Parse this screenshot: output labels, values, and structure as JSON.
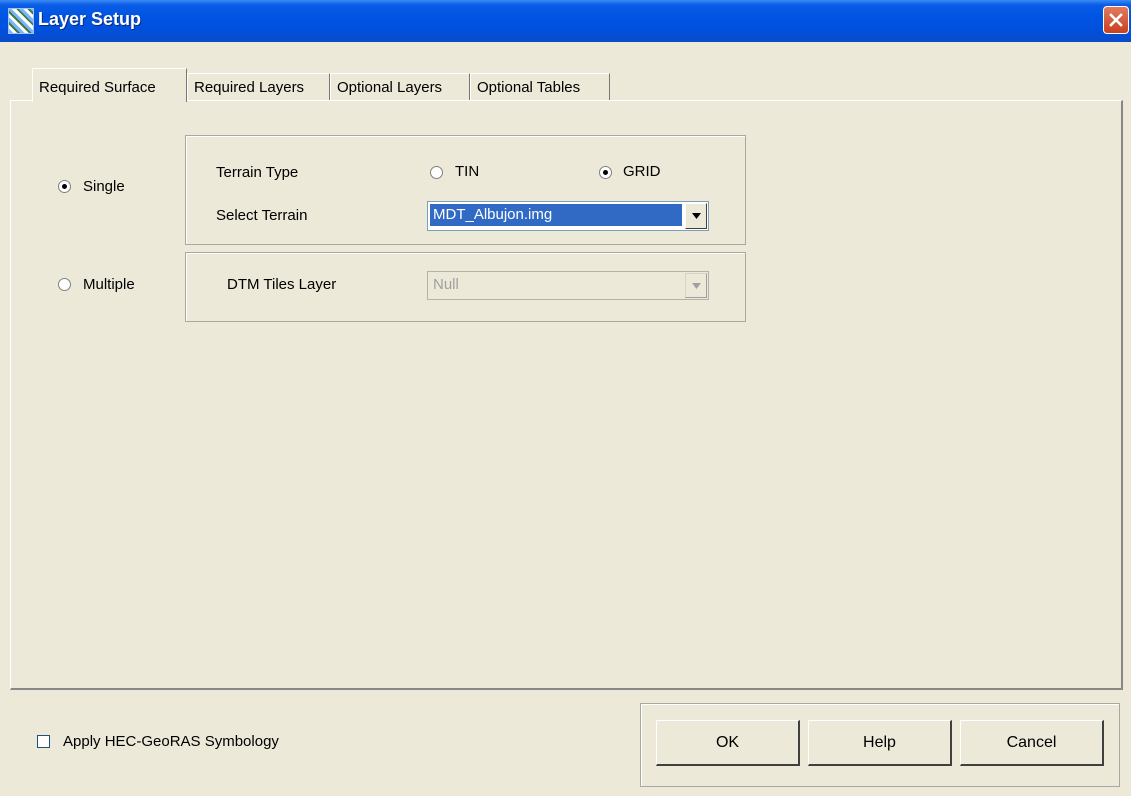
{
  "window": {
    "title": "Layer Setup"
  },
  "tabs": [
    {
      "label": "Required Surface",
      "active": true
    },
    {
      "label": "Required Layers",
      "active": false
    },
    {
      "label": "Optional Layers",
      "active": false
    },
    {
      "label": "Optional Tables",
      "active": false
    }
  ],
  "surface": {
    "single_label": "Single",
    "multiple_label": "Multiple",
    "selected_mode": "Single",
    "terrain_type_label": "Terrain Type",
    "tin_label": "TIN",
    "grid_label": "GRID",
    "selected_terrain_type": "GRID",
    "select_terrain_label": "Select Terrain",
    "select_terrain_value": "MDT_Albujon.img",
    "dtm_tiles_label": "DTM Tiles Layer",
    "dtm_tiles_value": "Null"
  },
  "footer": {
    "symbology_label": "Apply HEC-GeoRAS Symbology",
    "symbology_checked": false,
    "ok_label": "OK",
    "help_label": "Help",
    "cancel_label": "Cancel"
  },
  "colors": {
    "title_bar": "#0054e3",
    "dialog_bg": "#ece9d8",
    "selection": "#316ac5",
    "close_button": "#c9401f"
  },
  "icons": {
    "app": "layer-setup-app-icon",
    "close": "close-icon",
    "dropdown": "chevron-down-icon"
  }
}
